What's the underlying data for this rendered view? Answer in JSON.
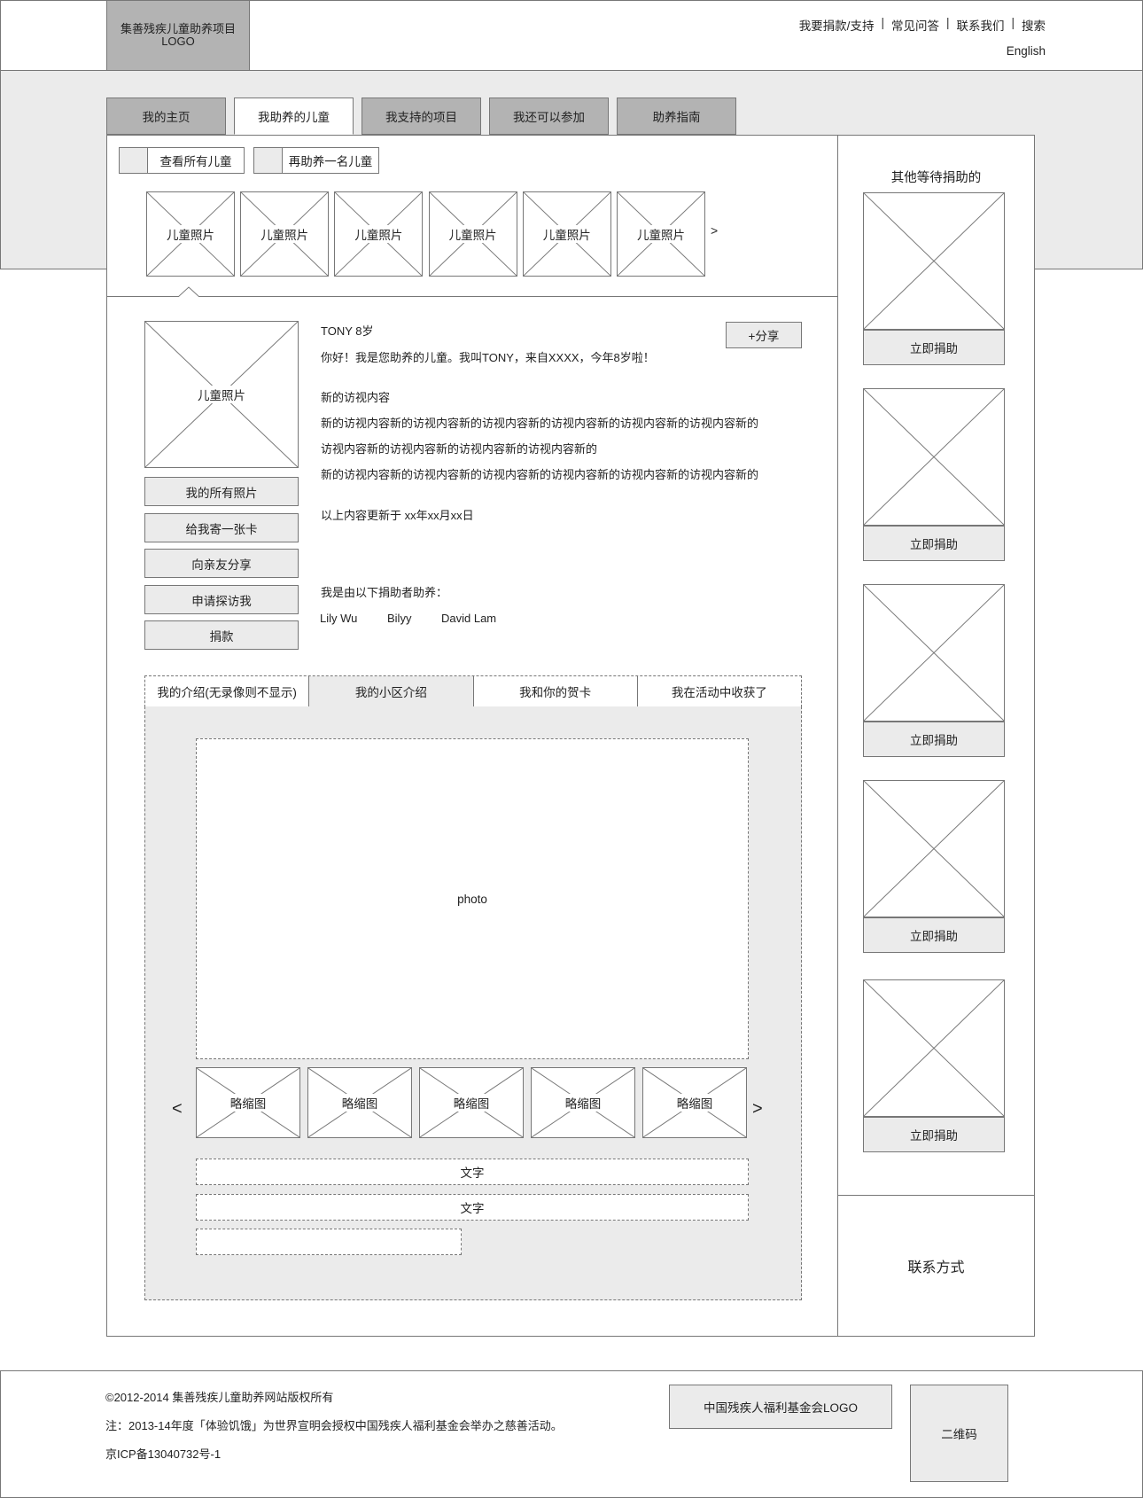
{
  "header": {
    "logo_line1": "集善残疾儿童助养项目",
    "logo_line2": "LOGO",
    "nav": [
      "我要捐款/支持",
      "常见问答",
      "联系我们",
      "搜索"
    ],
    "language": "English"
  },
  "tabs": [
    "我的主页",
    "我助养的儿童",
    "我支持的项目",
    "我还可以参加",
    "助养指南"
  ],
  "actions": {
    "view_all": "查看所有儿童",
    "sponsor_another": "再助养一名儿童"
  },
  "child_strip": {
    "items": [
      "儿童照片",
      "儿童照片",
      "儿童照片",
      "儿童照片",
      "儿童照片",
      "儿童照片"
    ],
    "next": ">"
  },
  "child": {
    "photo_label": "儿童照片",
    "name_age": "TONY 8岁",
    "greeting": "你好！我是您助养的儿童。我叫TONY，来自XXXX，今年8岁啦！",
    "share_button": "+分享",
    "visit_title": "新的访视内容",
    "visit_lines": [
      "新的访视内容新的访视内容新的访视内容新的访视内容新的访视内容新的访视内容新的",
      "访视内容新的访视内容新的访视内容新的访视内容新的",
      "新的访视内容新的访视内容新的访视内容新的访视内容新的访视内容新的访视内容新的"
    ],
    "updated": "以上内容更新于 xx年xx月xx日",
    "sponsors_title": "我是由以下捐助者助养：",
    "sponsors": [
      "Lily Wu",
      "Bilyy",
      "David Lam"
    ],
    "buttons": [
      "我的所有照片",
      "给我寄一张卡",
      "向亲友分享",
      "申请探访我",
      "捐款"
    ]
  },
  "content_tabs": [
    "我的介绍(无录像则不显示)",
    "我的小区介绍",
    "我和你的贺卡",
    "我在活动中收获了"
  ],
  "gallery": {
    "photo_label": "photo",
    "thumbs": [
      "略缩图",
      "略缩图",
      "略缩图",
      "略缩图",
      "略缩图"
    ],
    "prev": "<",
    "next": ">",
    "text1": "文字",
    "text2": "文字",
    "text3": ""
  },
  "sidebar": {
    "title": "其他等待捐助的",
    "donate_buttons": [
      "立即捐助",
      "立即捐助",
      "立即捐助",
      "立即捐助",
      "立即捐助"
    ],
    "contact": "联系方式"
  },
  "footer": {
    "copyright": "©2012-2014 集善残疾儿童助养网站版权所有",
    "note": "注：2013-14年度「体验饥饿」为世界宣明会授权中国残疾人福利基金会举办之慈善活动。",
    "icp": "京ICP备13040732号-1",
    "partner_logo": "中国残疾人福利基金会LOGO",
    "qr": "二维码"
  }
}
